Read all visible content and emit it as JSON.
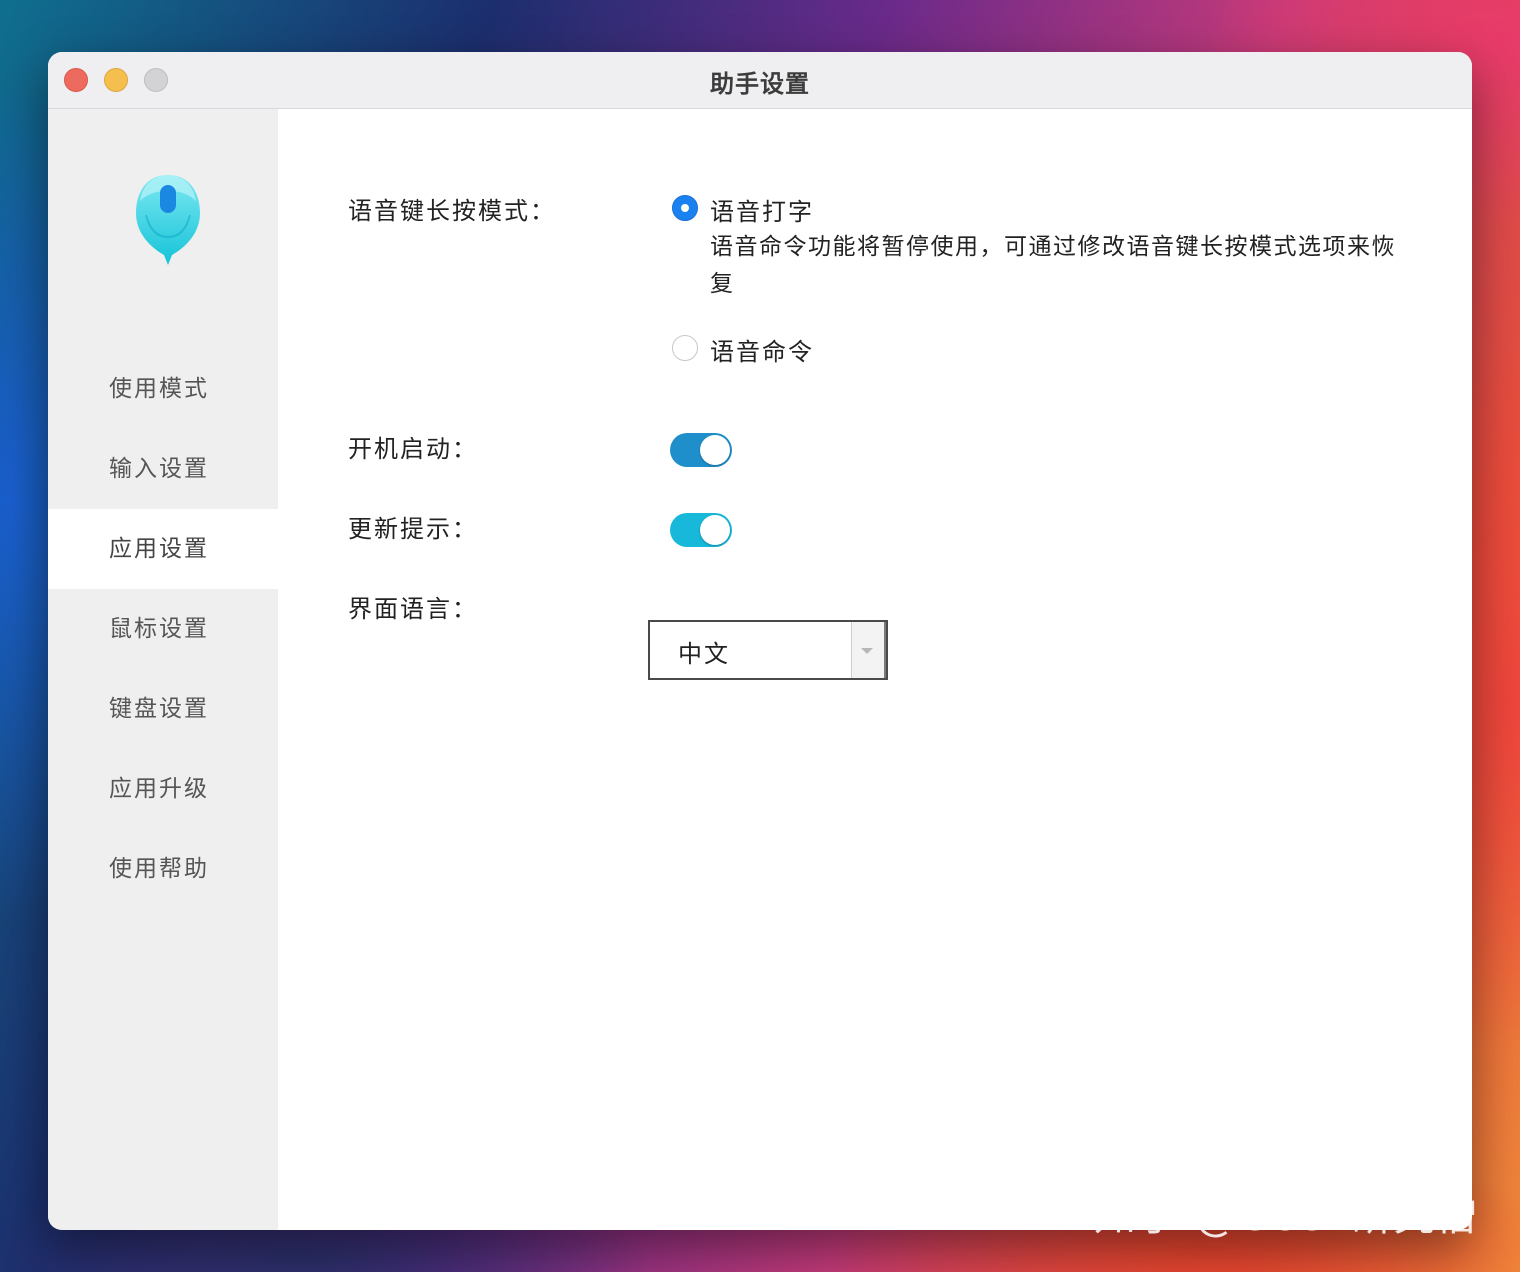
{
  "window": {
    "title": "助手设置"
  },
  "sidebar": {
    "items": [
      {
        "label": "使用模式",
        "active": false
      },
      {
        "label": "输入设置",
        "active": false
      },
      {
        "label": "应用设置",
        "active": true
      },
      {
        "label": "鼠标设置",
        "active": false
      },
      {
        "label": "键盘设置",
        "active": false
      },
      {
        "label": "应用升级",
        "active": false
      },
      {
        "label": "使用帮助",
        "active": false
      }
    ]
  },
  "settings": {
    "voice_key_mode": {
      "label": "语音键长按模式：",
      "options": [
        {
          "label": "语音打字",
          "checked": true,
          "description": "语音命令功能将暂停使用，可通过修改语音键长按模式选项来恢复"
        },
        {
          "label": "语音命令",
          "checked": false
        }
      ]
    },
    "startup": {
      "label": "开机启动：",
      "enabled": true,
      "color": "#1f8fcb"
    },
    "update_notice": {
      "label": "更新提示：",
      "enabled": true,
      "color": "#17b8d9"
    },
    "ui_language": {
      "label": "界面语言：",
      "value": "中文"
    }
  },
  "watermark": "知乎 @Geek研究僧",
  "colors": {
    "accent": "#1a82f0",
    "sidebar_bg": "#efefef"
  }
}
